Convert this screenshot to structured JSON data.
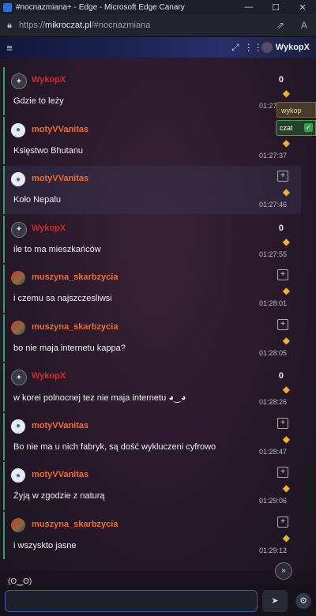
{
  "window": {
    "title": "#nocnazmiana+ - Edge - Microsoft Edge Canary",
    "minimize_icon": "minimize-icon",
    "maximize_icon": "maximize-icon",
    "close_icon": "close-icon"
  },
  "address_bar": {
    "url_prefix": "https://",
    "url_main": "mikroczat.pl",
    "url_rest": "/#nocnazmiana"
  },
  "header": {
    "brand": "WykopX"
  },
  "floating": {
    "wykop_label": "wykop",
    "czat_label": "czat",
    "emote_label": "(ʘ‿ʘ)"
  },
  "messages": [
    {
      "nick": "WykopX",
      "text": "Gdzie to leży",
      "score": "0",
      "time": "01:27:26",
      "nick_color": "red",
      "avatar": "bot"
    },
    {
      "nick": "motyVVanitas",
      "text": "Księstwo Bhutanu",
      "score": "",
      "time": "01:27:37",
      "nick_color": "orange",
      "avatar": "user"
    },
    {
      "nick": "motyVVanitas",
      "text": "Koło Nepalu",
      "score": "",
      "time": "01:27:46",
      "nick_color": "orange",
      "avatar": "user"
    },
    {
      "nick": "WykopX",
      "text": "ile to ma mieszkańców",
      "score": "0",
      "time": "01:27:55",
      "nick_color": "red",
      "avatar": "bot"
    },
    {
      "nick": "muszyna_skarbzycia",
      "text": "i czemu sa najszczesliwsi",
      "score": "",
      "time": "01:28:01",
      "nick_color": "orange",
      "avatar": "photo"
    },
    {
      "nick": "muszyna_skarbzycia",
      "text": "bo nie maja internetu kappa?",
      "score": "",
      "time": "01:28:05",
      "nick_color": "orange",
      "avatar": "photo"
    },
    {
      "nick": "WykopX",
      "text": "w korei polnocnej tez nie maja internetu ◕‿◕",
      "score": "0",
      "time": "01:28:26",
      "nick_color": "red",
      "avatar": "bot"
    },
    {
      "nick": "motyVVanitas",
      "text": "Bo nie ma u nich fabryk, są dość wykluczeni cyfrowo",
      "score": "",
      "time": "01:28:47",
      "nick_color": "orange",
      "avatar": "user"
    },
    {
      "nick": "motyVVanitas",
      "text": "Żyją w zgodzie z naturą",
      "score": "",
      "time": "01:29:06",
      "nick_color": "orange",
      "avatar": "user"
    },
    {
      "nick": "muszyna_skarbzycia",
      "text": "i wszyskto jasne",
      "score": "",
      "time": "01:29:12",
      "nick_color": "orange",
      "avatar": "photo"
    }
  ],
  "input": {
    "placeholder": ""
  },
  "icons": {
    "send": "send-icon",
    "settings": "settings-icon",
    "gem": "gem-icon",
    "plus": "plus-icon"
  }
}
